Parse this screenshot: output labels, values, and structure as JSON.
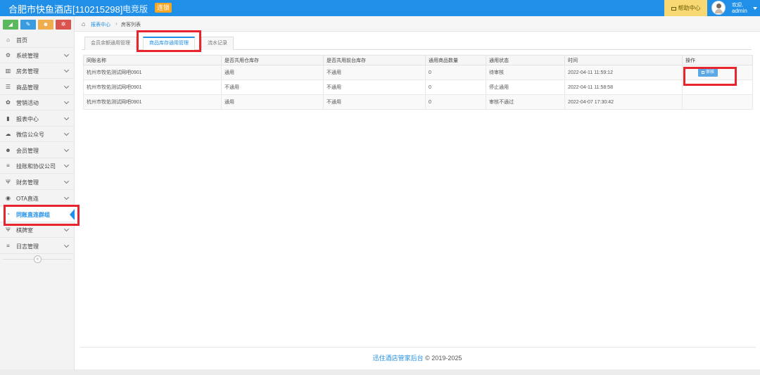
{
  "header": {
    "title": "合肥市快鱼酒店[110215298]",
    "subtitle": "电竞版",
    "badge": "连锁",
    "help": "帮助中心",
    "greeting": "欢迎,",
    "username": "admin"
  },
  "colors": {
    "primary": "#1f8fe8",
    "highlight": "#e8242f",
    "help_bg": "#f7d873",
    "badge": "#f5a623"
  },
  "sidebar": {
    "shortcuts": [
      {
        "icon": "chart-icon",
        "glyph": "◢",
        "color": "#5cb85c"
      },
      {
        "icon": "edit-icon",
        "glyph": "✎",
        "color": "#3a9be0"
      },
      {
        "icon": "users-icon",
        "glyph": "☻",
        "color": "#f0ad4e"
      },
      {
        "icon": "settings-icon",
        "glyph": "✲",
        "color": "#d9534f"
      }
    ],
    "items": [
      {
        "label": "首页",
        "icon": "home-icon",
        "glyph": "⌂",
        "chevron": false
      },
      {
        "label": "系统管理",
        "icon": "gear-icon",
        "glyph": "⚙",
        "chevron": true
      },
      {
        "label": "房务管理",
        "icon": "bank-icon",
        "glyph": "▥",
        "chevron": true
      },
      {
        "label": "商品管理",
        "icon": "database-icon",
        "glyph": "☰",
        "chevron": true
      },
      {
        "label": "营销活动",
        "icon": "gift-icon",
        "glyph": "✿",
        "chevron": true
      },
      {
        "label": "报表中心",
        "icon": "bar-chart-icon",
        "glyph": "▮",
        "chevron": true
      },
      {
        "label": "微信公众号",
        "icon": "cloud-icon",
        "glyph": "☁",
        "chevron": true
      },
      {
        "label": "会员管理",
        "icon": "users-icon",
        "glyph": "☻",
        "chevron": true
      },
      {
        "label": "挂账和协议公司",
        "icon": "list-icon",
        "glyph": "≡",
        "chevron": true
      },
      {
        "label": "财务管理",
        "icon": "cutlery-icon",
        "glyph": "Ψ",
        "chevron": true
      },
      {
        "label": "OTA直连",
        "icon": "eye-icon",
        "glyph": "◉",
        "chevron": true
      },
      {
        "label": "同账直连群组",
        "icon": "pie-chart-icon",
        "glyph": "◔",
        "chevron": false,
        "active": true
      },
      {
        "label": "棋牌室",
        "icon": "cutlery-icon",
        "glyph": "Ψ",
        "chevron": true
      },
      {
        "label": "日志管理",
        "icon": "list-icon",
        "glyph": "≡",
        "chevron": true
      }
    ],
    "collapse_glyph": "«"
  },
  "breadcrumb": {
    "home_glyph": "⌂",
    "c1": "报表中心",
    "sep": "›",
    "c2": "房客列表"
  },
  "tabs": [
    {
      "label": "会员余额通用管理",
      "active": false
    },
    {
      "label": "商品库存通用管理",
      "active": true
    },
    {
      "label": "流水记录",
      "active": false
    }
  ],
  "table": {
    "headers": [
      "同账名称",
      "是否共用仓库存",
      "是否共用前台库存",
      "通用商品数量",
      "通用状态",
      "时间",
      "操作"
    ],
    "rows": [
      [
        "杭州市牧佑测试网吧0901",
        "通用",
        "不通用",
        "0",
        "待审核",
        "2022-04-11 11:59:12"
      ],
      [
        "杭州市牧佑测试网吧0901",
        "不通用",
        "不通用",
        "0",
        "停止通用",
        "2022-04-11 11:58:58"
      ],
      [
        "杭州市牧佑测试网吧0901",
        "通用",
        "不通用",
        "0",
        "审核不通过",
        "2022-04-07 17:30:42"
      ]
    ],
    "action_label": "审核"
  },
  "footer": {
    "brand": "迅住酒店管家后台",
    "copyright": "© 2019-2025"
  }
}
